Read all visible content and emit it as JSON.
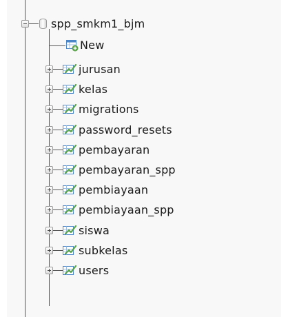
{
  "tree": {
    "database": {
      "name": "spp_smkm1_bjm",
      "expanded": true,
      "icon": "database-icon"
    },
    "new_item": {
      "label": "New",
      "icon": "new-table-icon"
    },
    "tables": [
      {
        "name": "jurusan",
        "icon": "table-icon"
      },
      {
        "name": "kelas",
        "icon": "table-icon"
      },
      {
        "name": "migrations",
        "icon": "table-icon"
      },
      {
        "name": "password_resets",
        "icon": "table-icon"
      },
      {
        "name": "pembayaran",
        "icon": "table-icon"
      },
      {
        "name": "pembayaran_spp",
        "icon": "table-icon"
      },
      {
        "name": "pembiayaan",
        "icon": "table-icon"
      },
      {
        "name": "pembiayaan_spp",
        "icon": "table-icon"
      },
      {
        "name": "siswa",
        "icon": "table-icon"
      },
      {
        "name": "subkelas",
        "icon": "table-icon"
      },
      {
        "name": "users",
        "icon": "table-icon"
      }
    ],
    "colors": {
      "icon_green": "#5aa34a",
      "icon_blue": "#4a86c8",
      "line": "#555555"
    }
  }
}
